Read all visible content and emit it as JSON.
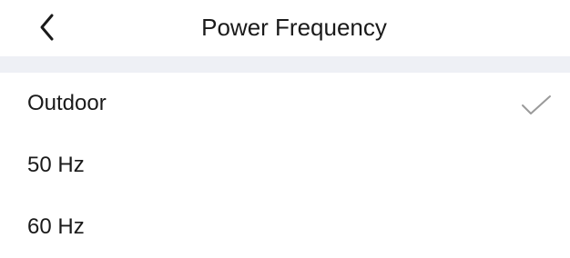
{
  "header": {
    "back_icon": "chevron-left-icon",
    "title": "Power Frequency"
  },
  "options": [
    {
      "label": "Outdoor",
      "selected": true
    },
    {
      "label": "50 Hz",
      "selected": false
    },
    {
      "label": "60 Hz",
      "selected": false
    }
  ],
  "colors": {
    "text": "#1a1a1a",
    "divider": "#eef0f5",
    "check": "#9a9a9a"
  },
  "check_icon": "checkmark-icon"
}
